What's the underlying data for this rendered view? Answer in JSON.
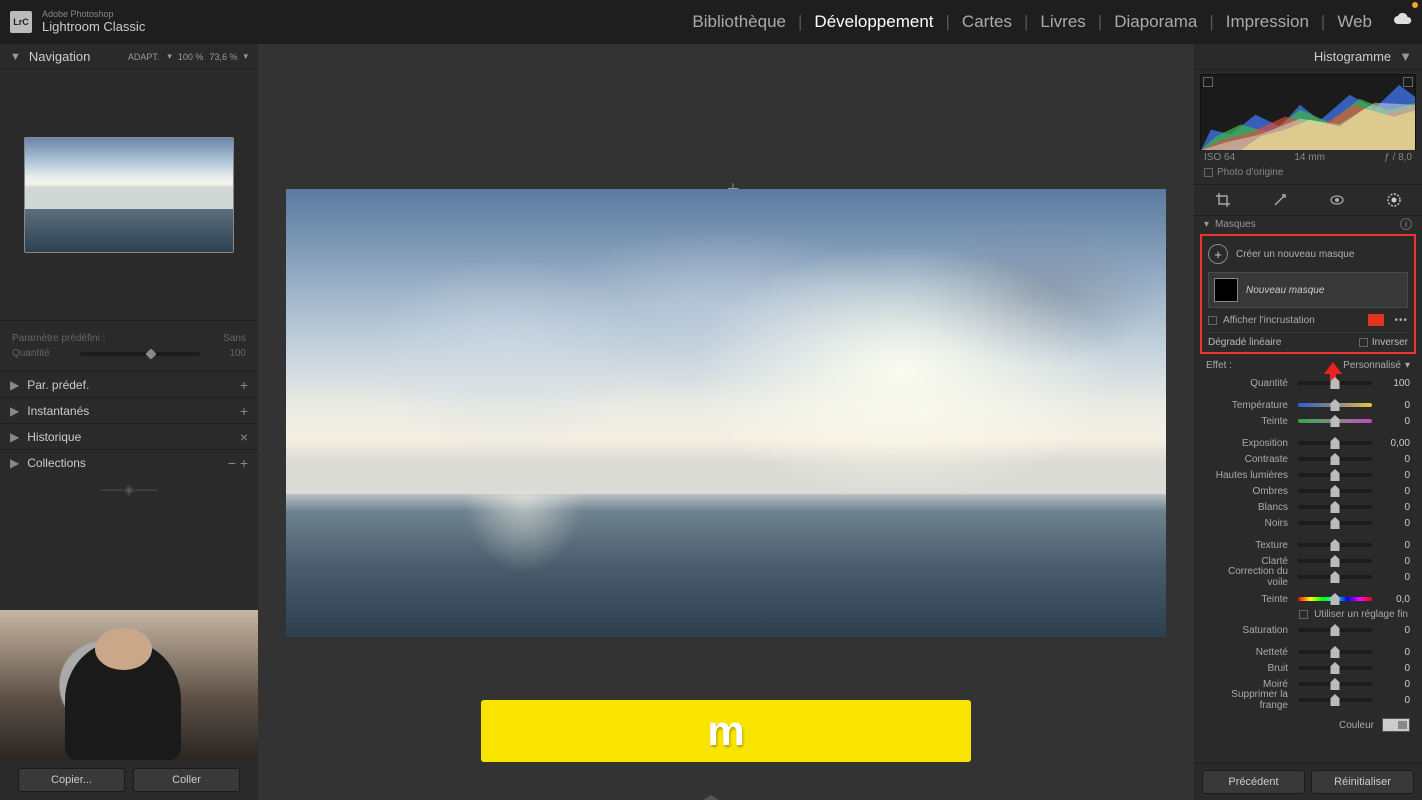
{
  "app": {
    "brand": "Adobe Photoshop",
    "product": "Lightroom Classic",
    "logo": "LrC"
  },
  "modules": {
    "items": [
      "Bibliothèque",
      "Développement",
      "Cartes",
      "Livres",
      "Diaporama",
      "Impression",
      "Web"
    ],
    "active": "Développement"
  },
  "leftPanel": {
    "navigator": {
      "title": "Navigation",
      "mode": "ADAPT.",
      "zoom1": "100 %",
      "zoom2": "73,6 %"
    },
    "preset": {
      "label": "Paramètre prédéfini :",
      "value": "Sans"
    },
    "amount": {
      "label": "Quantité",
      "value": "100"
    },
    "sections": {
      "presets": "Par. prédef.",
      "snapshots": "Instantanés",
      "history": "Historique",
      "collections": "Collections"
    },
    "buttons": {
      "copy": "Copier...",
      "paste": "Coller"
    }
  },
  "caption": "m",
  "rightPanel": {
    "histogram": {
      "title": "Histogramme",
      "iso": "ISO 64",
      "focal": "14 mm",
      "aperture": "ƒ / 8,0",
      "origin": "Photo d'origine"
    },
    "masks": {
      "title": "Masques",
      "create": "Créer un nouveau masque",
      "item": "Nouveau masque",
      "showOverlay": "Afficher l'incrustation",
      "gradient": "Dégradé linéaire",
      "invert": "Inverser"
    },
    "effect": {
      "label": "Effet :",
      "value": "Personnalisé"
    },
    "amount": {
      "label": "Quantité",
      "value": "100"
    },
    "sliders": {
      "temperature": {
        "label": "Température",
        "value": "0"
      },
      "tint": {
        "label": "Teinte",
        "value": "0"
      },
      "exposure": {
        "label": "Exposition",
        "value": "0,00"
      },
      "contrast": {
        "label": "Contraste",
        "value": "0"
      },
      "highlights": {
        "label": "Hautes lumières",
        "value": "0"
      },
      "shadows": {
        "label": "Ombres",
        "value": "0"
      },
      "whites": {
        "label": "Blancs",
        "value": "0"
      },
      "blacks": {
        "label": "Noirs",
        "value": "0"
      },
      "texture": {
        "label": "Texture",
        "value": "0"
      },
      "clarity": {
        "label": "Clarté",
        "value": "0"
      },
      "dehaze": {
        "label": "Correction du voile",
        "value": "0"
      },
      "hue": {
        "label": "Teinte",
        "value": "0,0"
      },
      "saturation": {
        "label": "Saturation",
        "value": "0"
      },
      "sharpness": {
        "label": "Netteté",
        "value": "0"
      },
      "noise": {
        "label": "Bruit",
        "value": "0"
      },
      "moire": {
        "label": "Moiré",
        "value": "0"
      },
      "defringe": {
        "label": "Supprimer la frange",
        "value": "0"
      }
    },
    "fineAdjust": "Utiliser un réglage fin",
    "colorLabel": "Couleur",
    "buttons": {
      "prev": "Précédent",
      "reset": "Réinitialiser"
    }
  }
}
